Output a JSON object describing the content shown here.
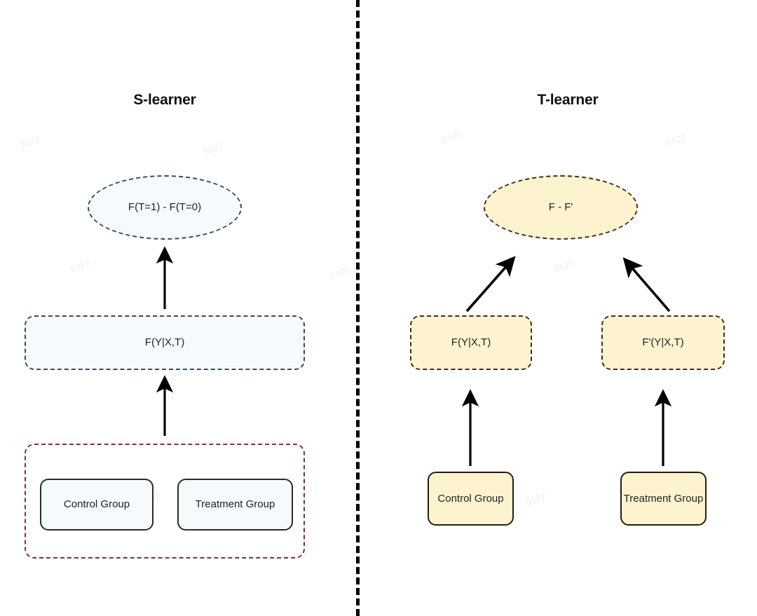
{
  "figure": {
    "divider_color": "#000000",
    "background": "#ffffff"
  },
  "panels": [
    {
      "id": "s-learner",
      "title": "S-learner",
      "accent_fill": "#f5fafd",
      "accent_border": "#3c4a5c",
      "group_border": "#7c3434",
      "nodes": {
        "output": "F(T=1) - F(T=0)",
        "model": "F(Y|X,T)",
        "control": "Control Group",
        "treatment": "Treatment Group"
      }
    },
    {
      "id": "t-learner",
      "title": "T-learner",
      "accent_fill": "#fdf3cf",
      "accent_border": "#3a2f20",
      "nodes": {
        "output": "F - F'",
        "model_control": "F(Y|X,T)",
        "model_treatment": "F'(Y|X,T)",
        "control": "Control Group",
        "treatment": "Treatment Group"
      }
    }
  ]
}
